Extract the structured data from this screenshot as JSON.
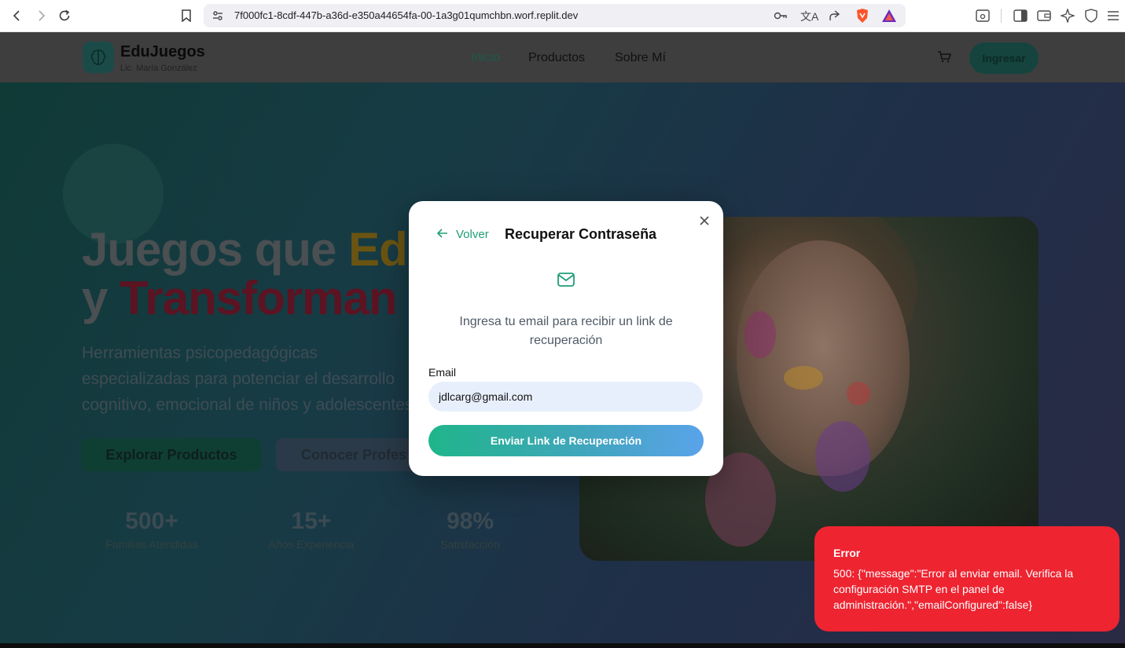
{
  "browser": {
    "url": "7f000fc1-8cdf-447b-a36d-e350a44654fa-00-1a3g01qumchbn.worf.replit.dev"
  },
  "site": {
    "brand_name": "EduJuegos",
    "brand_subtitle": "Lic. María González",
    "nav": [
      "Inicio",
      "Productos",
      "Sobre Mí"
    ],
    "login_label": "Ingresar"
  },
  "hero": {
    "title_word1": "Juegos que ",
    "title_word2": "Ed",
    "title_line2_a": "y ",
    "title_line2_b": "Transforman",
    "subtitle": "Herramientas psicopedagógicas especializadas para potenciar el desarrollo cognitivo, emocional de niños y adolescentes.",
    "primary_button": "Explorar Productos",
    "secondary_button": "Conocer Profes",
    "stats": [
      {
        "value": "500+",
        "label": "Familias Atendidas"
      },
      {
        "value": "15+",
        "label": "Años Experiencia"
      },
      {
        "value": "98%",
        "label": "Satisfacción"
      }
    ]
  },
  "modal": {
    "back_label": "Volver",
    "title": "Recuperar Contraseña",
    "description": "Ingresa tu email para recibir un link de recuperación",
    "email_label": "Email",
    "email_value": "jdlcarg@gmail.com",
    "submit_label": "Enviar Link de Recuperación"
  },
  "toast": {
    "title": "Error",
    "message": "500: {\"message\":\"Error al enviar email. Verifica la configuración SMTP en el panel de administración.\",\"emailConfigured\":false}"
  },
  "colors": {
    "accent": "#1f9d78",
    "error": "#ee2431"
  }
}
